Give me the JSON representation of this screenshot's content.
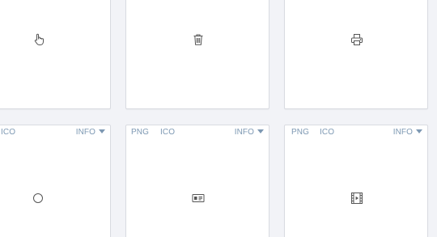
{
  "colors": {
    "background": "#f2f3f7",
    "card": "#ffffff",
    "card_border": "#d9dbe1",
    "tag_text": "#7d98b3",
    "icon": "#555555"
  },
  "top_row": [
    {
      "icon": "hand-pointer-icon"
    },
    {
      "icon": "trash-icon"
    },
    {
      "icon": "print-icon"
    }
  ],
  "bottom_row": [
    {
      "formats": [
        "ICO"
      ],
      "info_label": "INFO",
      "icon": "circle-icon"
    },
    {
      "formats": [
        "PNG",
        "ICO"
      ],
      "info_label": "INFO",
      "icon": "id-card-icon"
    },
    {
      "formats": [
        "PNG",
        "ICO"
      ],
      "info_label": "INFO",
      "icon": "film-icon"
    }
  ]
}
